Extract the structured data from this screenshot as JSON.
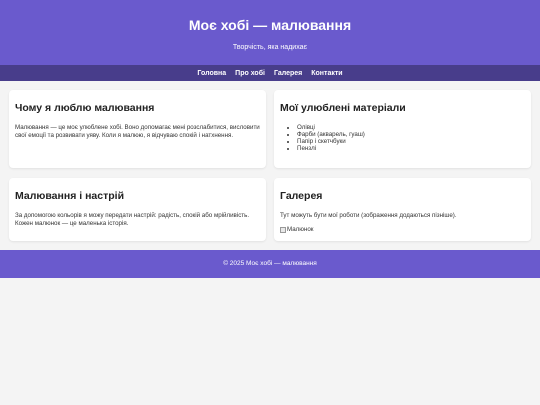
{
  "header": {
    "title": "Моє хобі — малювання",
    "subtitle": "Творчість, яка надихає"
  },
  "nav": {
    "items": [
      "Головна",
      "Про хобі",
      "Галерея",
      "Контакти"
    ]
  },
  "cards": {
    "why": {
      "title": "Чому я люблю малювання",
      "text": "Малювання — це моє улюблене хобі. Воно допомагає мені розслабитися, висловити свої емоції та розвивати уяву. Коли я малюю, я відчуваю спокій і натхнення."
    },
    "materials": {
      "title": "Мої улюблені матеріали",
      "items": [
        "Олівці",
        "Фарби (акварель, гуаш)",
        "Папір і скетчбуки",
        "Пензлі"
      ]
    },
    "mood": {
      "title": "Малювання і настрій",
      "text": "За допомогою кольорів я можу передати настрій: радість, спокій або мрійливість. Кожен малюнок — це маленька історія."
    },
    "gallery": {
      "title": "Галерея",
      "text": "Тут можуть бути мої роботи (зображення додаються пізніше).",
      "image_alt": "Малюнок"
    }
  },
  "footer": {
    "text": "© 2025 Моє хобі — малювання"
  },
  "colors": {
    "header_bg": "#6a5acd",
    "nav_bg": "#483d8b",
    "page_bg": "#f4f4f4"
  }
}
